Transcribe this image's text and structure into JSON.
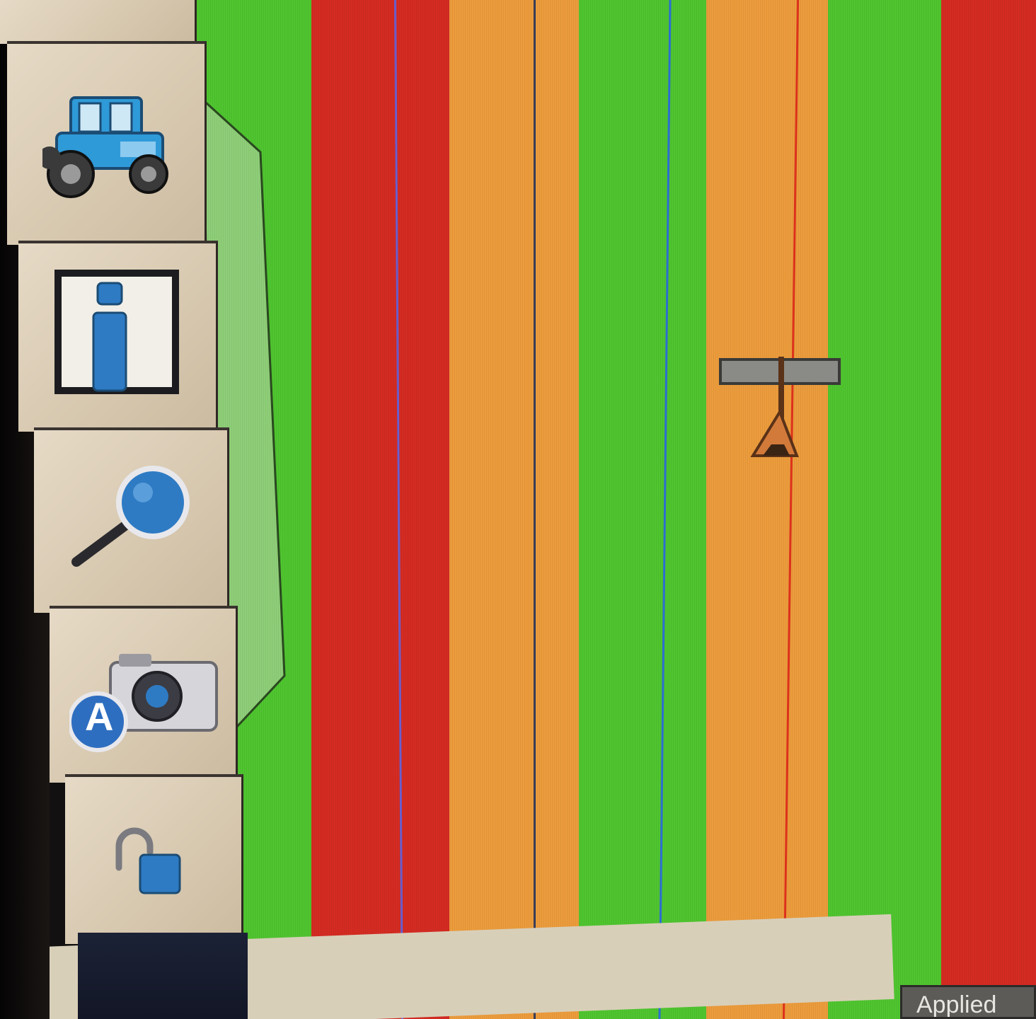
{
  "toolbar": {
    "buttons": [
      {
        "name": "vehicle-button",
        "icon": "tractor-icon"
      },
      {
        "name": "info-button",
        "icon": "info-icon"
      },
      {
        "name": "zoom-button",
        "icon": "magnifier-icon"
      },
      {
        "name": "auto-camera-button",
        "icon": "camera-auto-icon"
      },
      {
        "name": "unlock-button",
        "icon": "unlock-icon"
      }
    ],
    "camera_badge_letter": "A"
  },
  "map": {
    "stripe_colors": {
      "green": "#4fc52f",
      "red": "#d42b22",
      "orange": "#ec9c3c",
      "light_green": "#8fce78"
    },
    "guide_colors": {
      "purple": "#6a5fd0",
      "blue": "#2e6fd6",
      "red": "#e0321c",
      "dark": "#3a3f5a"
    },
    "vehicle_marker": "tractor-position-marker"
  },
  "status": {
    "applied_label": "Applied"
  }
}
